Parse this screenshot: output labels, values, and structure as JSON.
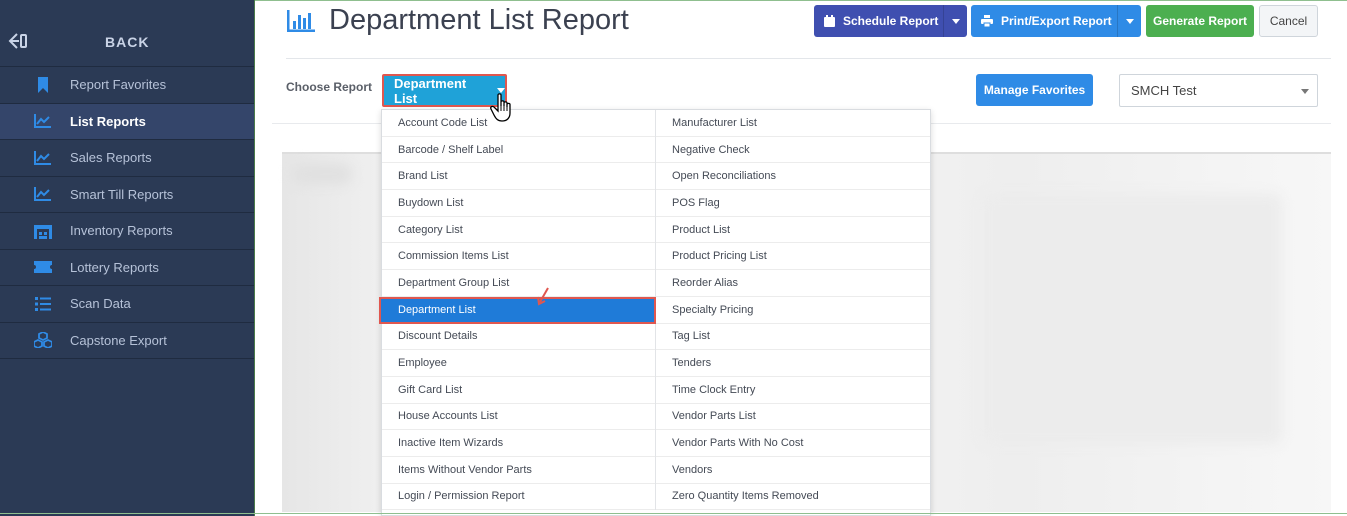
{
  "sidebar": {
    "back_label": "BACK",
    "items": [
      {
        "label": "Report Favorites",
        "icon": "bookmark-icon",
        "active": false
      },
      {
        "label": "List Reports",
        "icon": "line-chart-icon",
        "active": true
      },
      {
        "label": "Sales Reports",
        "icon": "line-chart-icon",
        "active": false
      },
      {
        "label": "Smart Till Reports",
        "icon": "line-chart-icon",
        "active": false
      },
      {
        "label": "Inventory Reports",
        "icon": "warehouse-icon",
        "active": false
      },
      {
        "label": "Lottery Reports",
        "icon": "ticket-icon",
        "active": false
      },
      {
        "label": "Scan Data",
        "icon": "list-icon",
        "active": false
      },
      {
        "label": "Capstone Export",
        "icon": "cubes-icon",
        "active": false
      }
    ]
  },
  "header": {
    "title": "Department List Report",
    "title_icon": "bar-chart-icon",
    "schedule_label": "Schedule Report",
    "print_label": "Print/Export Report",
    "generate_label": "Generate Report",
    "cancel_label": "Cancel"
  },
  "controls": {
    "choose_label": "Choose Report",
    "report_button_label": "Department List",
    "manage_favorites_label": "Manage Favorites",
    "store_selected": "SMCH Test"
  },
  "dropdown": {
    "left": [
      "Account Code List",
      "Barcode / Shelf Label",
      "Brand List",
      "Buydown List",
      "Category List",
      "Commission Items List",
      "Department Group List",
      "Department List",
      "Discount Details",
      "Employee",
      "Gift Card List",
      "House Accounts List",
      "Inactive Item Wizards",
      "Items Without Vendor Parts",
      "Login / Permission Report"
    ],
    "right": [
      "Manufacturer List",
      "Negative Check",
      "Open Reconciliations",
      "POS Flag",
      "Product List",
      "Product Pricing List",
      "Reorder Alias",
      "Specialty Pricing",
      "Tag List",
      "Tenders",
      "Time Clock Entry",
      "Vendor Parts List",
      "Vendor Parts With No Cost",
      "Vendors",
      "Zero Quantity Items Removed"
    ],
    "selected": "Department List"
  },
  "colors": {
    "sidebar_bg": "#2b3a55",
    "accent_blue": "#2f8be6",
    "schedule_indigo": "#3f4fb0",
    "generate_green": "#4caf50",
    "highlight_red": "#e0574f"
  }
}
